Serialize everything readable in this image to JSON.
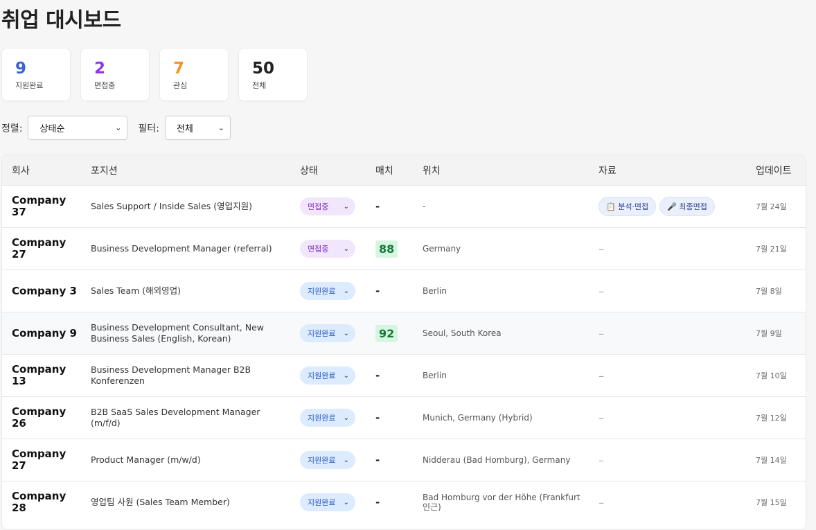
{
  "page": {
    "title": "취업 대시보드"
  },
  "stats": [
    {
      "value": "9",
      "label": "지원완료",
      "color": "#3b63d8"
    },
    {
      "value": "2",
      "label": "면접중",
      "color": "#9333ea"
    },
    {
      "value": "7",
      "label": "관심",
      "color": "#f59325"
    },
    {
      "value": "50",
      "label": "전체",
      "color": "#222222"
    }
  ],
  "controls": {
    "sort_label": "정렬:",
    "sort_value": "상태순",
    "filter_label": "필터:",
    "filter_value": "전체"
  },
  "table": {
    "headers": [
      "회사",
      "포지션",
      "상태",
      "매치",
      "위치",
      "자료",
      "업데이트"
    ],
    "rows": [
      {
        "company": "Company 37",
        "position": "Sales Support / Inside Sales (영업지원)",
        "status": "면접중",
        "match": "-",
        "location": "-",
        "docs": [
          "📋 분석·면접",
          "🎤 최종면접"
        ],
        "updated": "7월 24일"
      },
      {
        "company": "Company 27",
        "position": "Business Development Manager (referral)",
        "status": "면접중",
        "match": "88",
        "location": "Germany",
        "docs": [],
        "docs_empty": "–",
        "updated": "7월 21일"
      },
      {
        "company": "Company 3",
        "position": "Sales Team (해외영업)",
        "status": "지원완료",
        "match": "-",
        "location": "Berlin",
        "docs": [],
        "docs_empty": "–",
        "updated": "7월 8일"
      },
      {
        "company": "Company 9",
        "position": "Business Development Consultant, New Business Sales (English, Korean)",
        "status": "지원완료",
        "match": "92",
        "location": "Seoul, South Korea",
        "docs": [],
        "docs_empty": "–",
        "updated": "7월 9일"
      },
      {
        "company": "Company 13",
        "position": "Business Development Manager B2B Konferenzen",
        "status": "지원완료",
        "match": "-",
        "location": "Berlin",
        "docs": [],
        "docs_empty": "–",
        "updated": "7월 10일"
      },
      {
        "company": "Company 26",
        "position": "B2B SaaS Sales Development Manager (m/f/d)",
        "status": "지원완료",
        "match": "-",
        "location": "Munich, Germany (Hybrid)",
        "docs": [],
        "docs_empty": "–",
        "updated": "7월 12일"
      },
      {
        "company": "Company 27",
        "position": "Product Manager (m/w/d)",
        "status": "지원완료",
        "match": "-",
        "location": "Nidderau (Bad Homburg), Germany",
        "docs": [],
        "docs_empty": "–",
        "updated": "7월 14일"
      },
      {
        "company": "Company 28",
        "position": "영업팀 사원 (Sales Team Member)",
        "status": "지원완료",
        "match": "-",
        "location": "Bad Homburg vor der Höhe (Frankfurt 인근)",
        "docs": [],
        "docs_empty": "–",
        "updated": "7월 15일"
      }
    ]
  }
}
